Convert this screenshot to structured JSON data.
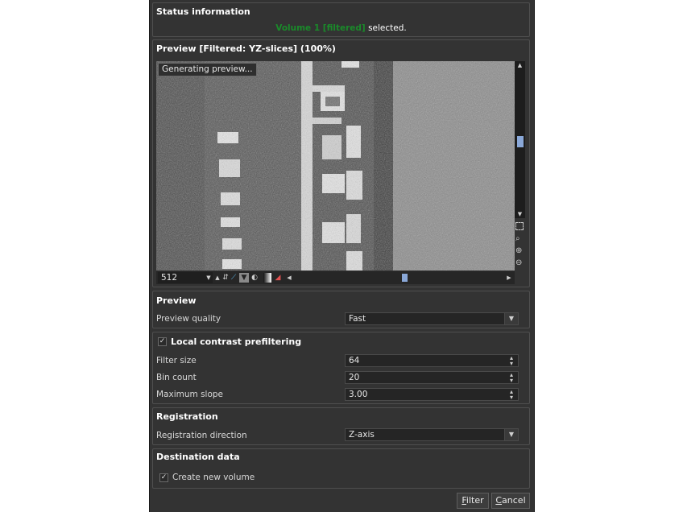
{
  "status": {
    "title": "Status information",
    "message_volume": "Volume 1 [filtered]",
    "message_suffix": " selected."
  },
  "preview_panel": {
    "title": "Preview [Filtered: YZ-slices] (100%)",
    "overlay": "Generating preview...",
    "slice_value": "512",
    "vertical_scroll_position": 0.45,
    "horizontal_scroll_position": 0.5
  },
  "preview_section": {
    "title": "Preview",
    "quality_label": "Preview quality",
    "quality_value": "Fast"
  },
  "contrast": {
    "title": "Local contrast prefiltering",
    "enabled": true,
    "filter_size_label": "Filter size",
    "filter_size_value": "64",
    "bin_count_label": "Bin count",
    "bin_count_value": "20",
    "max_slope_label": "Maximum slope",
    "max_slope_value": "3.00"
  },
  "registration": {
    "title": "Registration",
    "direction_label": "Registration direction",
    "direction_value": "Z-axis"
  },
  "destination": {
    "title": "Destination data",
    "create_label": "Create new volume",
    "create_checked": true
  },
  "buttons": {
    "filter_first": "F",
    "filter_rest": "ilter",
    "cancel_first": "C",
    "cancel_rest": "ancel"
  },
  "colors": {
    "dialog_bg": "#333333",
    "accent_green": "#1a8a2a",
    "panel_border": "#4f4f4f"
  }
}
